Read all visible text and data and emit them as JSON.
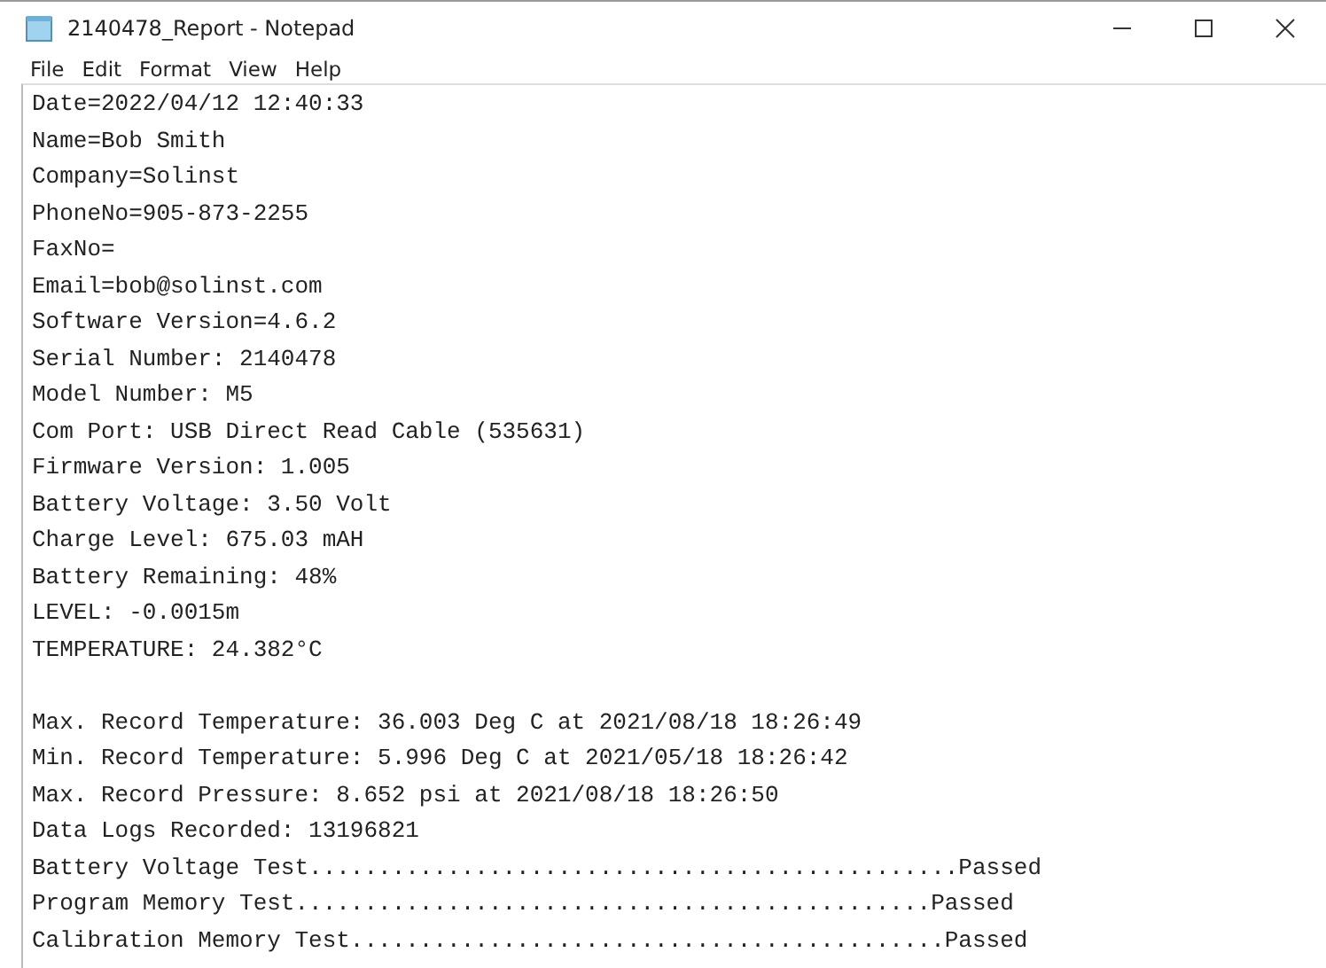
{
  "window": {
    "title": "2140478_Report - Notepad"
  },
  "menu": [
    "File",
    "Edit",
    "Format",
    "View",
    "Help"
  ],
  "document": {
    "sections": [
      [
        "Date=2022/04/12 12:40:33",
        "Name=Bob Smith",
        "Company=Solinst",
        "PhoneNo=905-873-2255",
        "FaxNo=",
        "Email=bob@solinst.com",
        "Software Version=4.6.2",
        "Serial Number: 2140478",
        "Model Number: M5",
        "Com Port: USB Direct Read Cable (535631)",
        "Firmware Version: 1.005",
        "Battery Voltage: 3.50 Volt",
        "Charge Level: 675.03 mAH",
        "Battery Remaining: 48%",
        "LEVEL: -0.0015m",
        "TEMPERATURE: 24.382°C"
      ],
      [
        "Max. Record Temperature: 36.003 Deg C at 2021/08/18 18:26:49",
        "Min. Record Temperature: 5.996 Deg C at 2021/05/18 18:26:42",
        "Max. Record Pressure: 8.652 psi at 2021/08/18 18:26:50",
        "Data Logs Recorded: 13196821",
        "Battery Voltage Test...............................................Passed",
        "Program Memory Test..............................................Passed",
        "Calibration Memory Test...........................................Passed"
      ]
    ]
  }
}
